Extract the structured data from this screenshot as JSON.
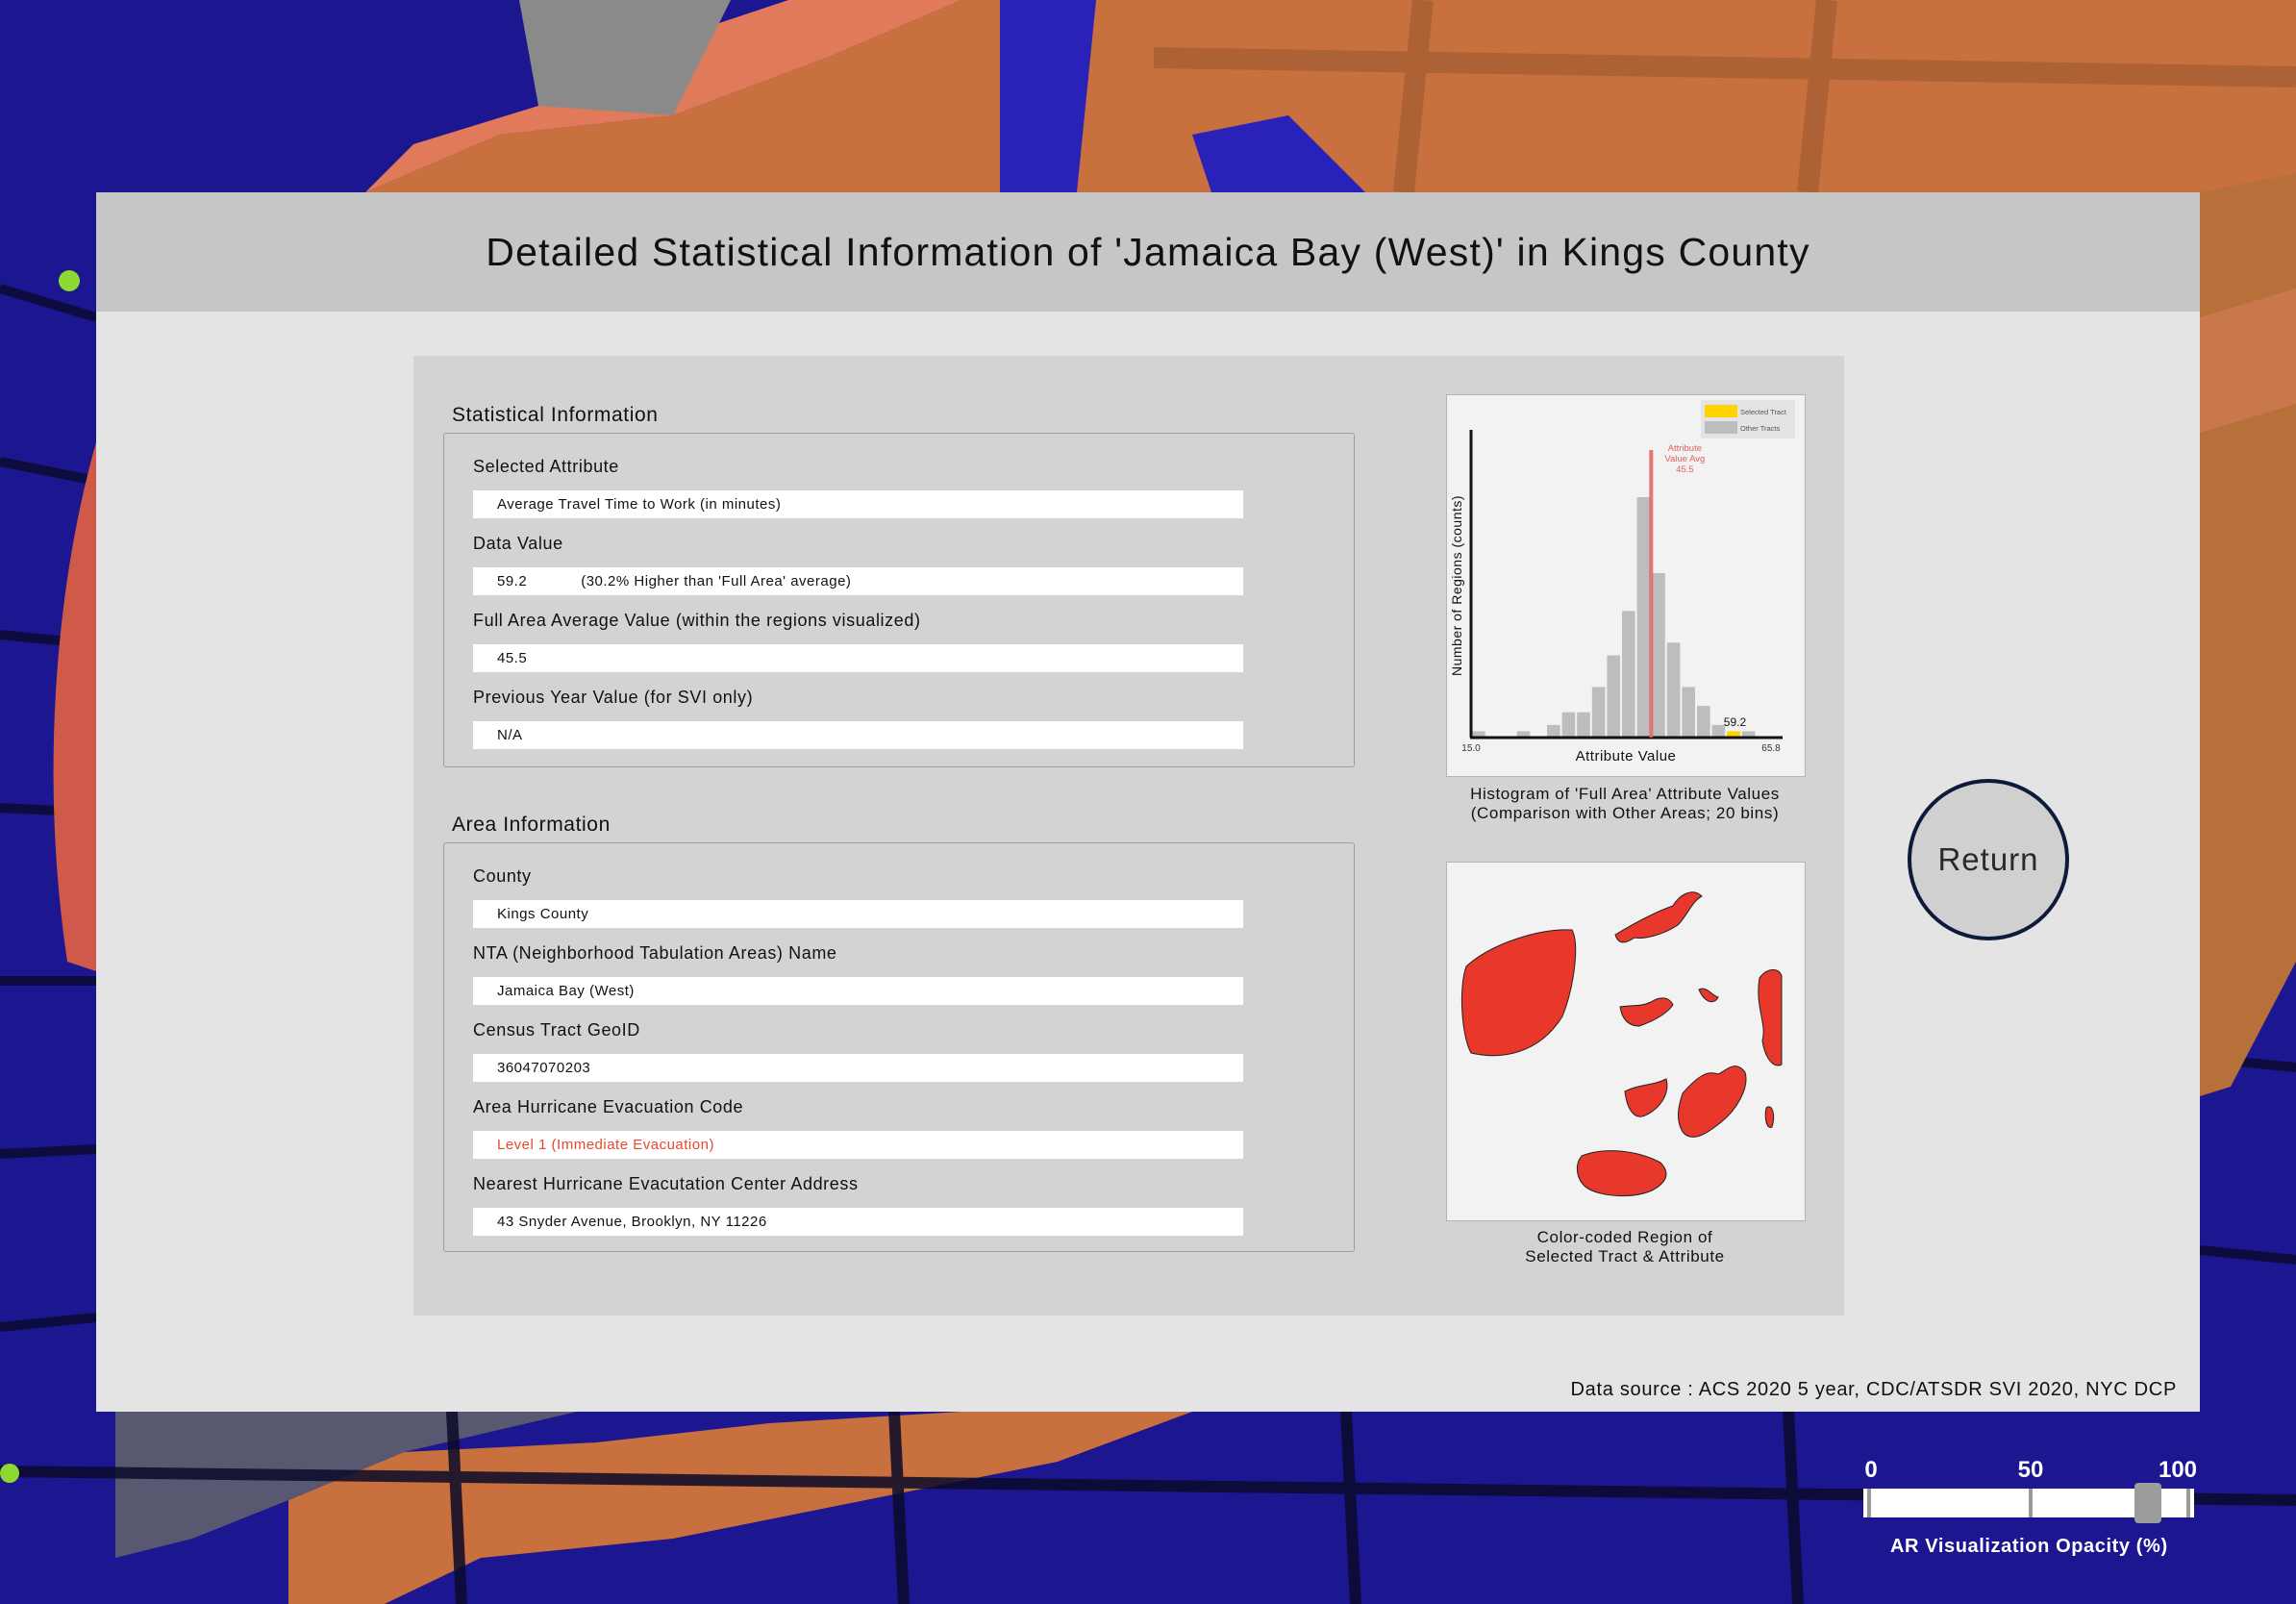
{
  "header": {
    "title": "Detailed Statistical Information of 'Jamaica Bay (West)' in Kings County"
  },
  "statistical_info": {
    "section_title": "Statistical Information",
    "fields": [
      {
        "label": "Selected Attribute",
        "value": "Average Travel Time to Work (in minutes)"
      },
      {
        "label": "Data Value",
        "value": "59.2            (30.2% Higher than 'Full Area' average)"
      },
      {
        "label": "Full Area Average Value (within the regions visualized)",
        "value": "45.5"
      },
      {
        "label": "Previous Year Value (for SVI only)",
        "value": "N/A"
      }
    ]
  },
  "area_info": {
    "section_title": "Area Information",
    "fields": [
      {
        "label": "County",
        "value": "Kings County"
      },
      {
        "label": "NTA (Neighborhood Tabulation Areas) Name",
        "value": "Jamaica Bay (West)"
      },
      {
        "label": "Census Tract GeoID",
        "value": "36047070203"
      },
      {
        "label": "Area Hurricane Evacuation Code",
        "value": "Level 1 (Immediate Evacuation)"
      },
      {
        "label": "Nearest Hurricane Evacutation Center Address",
        "value": "43 Snyder Avenue, Brooklyn, NY 11226"
      }
    ]
  },
  "histogram": {
    "caption_line1": "Histogram of 'Full Area' Attribute Values",
    "caption_line2": "(Comparison with Other Areas; 20 bins)"
  },
  "chart_data": {
    "type": "bar",
    "xlabel": "Attribute Value",
    "ylabel": "Number of Regions (counts)",
    "x_min_label": "15.0",
    "x_max_label": "65.8",
    "xlim": [
      15.0,
      65.8
    ],
    "bins": 20,
    "legend": [
      "Selected Tract",
      "Other Tracts"
    ],
    "legend_position": "top-right",
    "avg_line_label": [
      "Attribute",
      "Value Avg",
      "45.5"
    ],
    "avg_value": 45.5,
    "selected_value": 59.2,
    "selected_label": "59.2",
    "counts": [
      1,
      0,
      0,
      1,
      0,
      2,
      4,
      4,
      8,
      13,
      20,
      38,
      26,
      15,
      8,
      5,
      2,
      1,
      1,
      0
    ],
    "selected_bin": 17,
    "colors": {
      "selected": "#ffd200",
      "other": "#bdbdbd",
      "avg": "#e06060"
    }
  },
  "region_map": {
    "caption_line1": "Color-coded Region of",
    "caption_line2": "Selected Tract & Attribute",
    "fill": "#e8372b"
  },
  "footer": {
    "source": "Data source : ACS 2020 5 year, CDC/ATSDR SVI 2020, NYC DCP"
  },
  "return_button": {
    "label": "Return"
  },
  "opacity_slider": {
    "ticks": [
      "0",
      "50",
      "100"
    ],
    "value": 88,
    "caption": "AR Visualization Opacity (%)"
  }
}
